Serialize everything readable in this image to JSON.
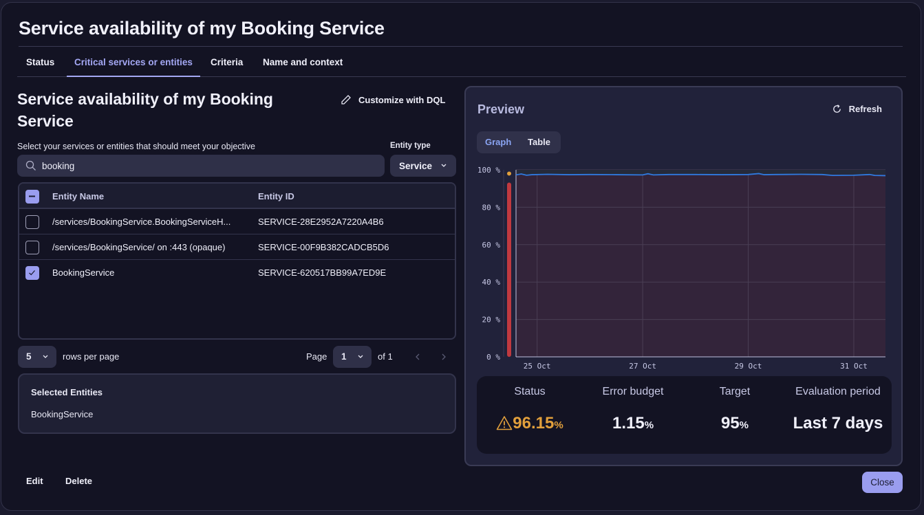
{
  "modal": {
    "title": "Service availability of my Booking Service",
    "tabs": [
      {
        "label": "Status",
        "active": false
      },
      {
        "label": "Critical services or entities",
        "active": true
      },
      {
        "label": "Criteria",
        "active": false
      },
      {
        "label": "Name and context",
        "active": false
      }
    ]
  },
  "left": {
    "title": "Service availability of my Booking Service",
    "customize_label": "Customize with DQL",
    "select_label": "Select your services or entities that should meet your objective",
    "entity_type_label": "Entity type",
    "entity_type_value": "Service",
    "search_value": "booking",
    "table": {
      "headers": [
        "Entity Name",
        "Entity ID"
      ],
      "rows": [
        {
          "name": "/services/BookingService.BookingServiceH...",
          "id": "SERVICE-28E2952A7220A4B6",
          "checked": false
        },
        {
          "name": "/services/BookingService/ on :443 (opaque)",
          "id": "SERVICE-00F9B382CADCB5D6",
          "checked": false
        },
        {
          "name": "BookingService",
          "id": "SERVICE-620517BB99A7ED9E",
          "checked": true
        }
      ]
    },
    "pagination": {
      "rows_per_page": "5",
      "rows_per_page_label": "rows per page",
      "page_label": "Page",
      "page": "1",
      "of_label": "of 1"
    },
    "selected": {
      "title": "Selected Entities",
      "items": [
        "BookingService"
      ]
    }
  },
  "preview": {
    "title": "Preview",
    "refresh_label": "Refresh",
    "view_tabs": [
      {
        "label": "Graph",
        "active": true
      },
      {
        "label": "Table",
        "active": false
      }
    ],
    "stats": [
      {
        "label": "Status",
        "value": "96.15",
        "unit": "%",
        "warning": true
      },
      {
        "label": "Error budget",
        "value": "1.15",
        "unit": "%",
        "warning": false
      },
      {
        "label": "Target",
        "value": "95",
        "unit": "%",
        "warning": false
      },
      {
        "label": "Evaluation period",
        "value": "Last 7 days",
        "unit": "",
        "warning": false
      }
    ]
  },
  "footer": {
    "edit_label": "Edit",
    "delete_label": "Delete",
    "close_label": "Close"
  },
  "colors": {
    "accent": "#9a9def",
    "warning": "#e2a03c",
    "series": "#2f7ae0",
    "status_bar": "#c0393f",
    "plot_bg": "#33243a"
  },
  "chart_data": {
    "type": "line",
    "title": "",
    "xlabel": "",
    "ylabel": "",
    "ylim": [
      0,
      100
    ],
    "y_ticks": [
      "0 %",
      "20 %",
      "40 %",
      "60 %",
      "80 %",
      "100 %"
    ],
    "y_tick_values": [
      0,
      20,
      40,
      60,
      80,
      100
    ],
    "x_ticks": [
      "25 Oct",
      "27 Oct",
      "29 Oct",
      "31 Oct"
    ],
    "x_range_days": [
      24.6,
      31.6
    ],
    "x_tick_days": [
      25,
      27,
      29,
      31
    ],
    "grid": true,
    "series": [
      {
        "name": "availability",
        "x_days": [
          24.6,
          24.7,
          24.8,
          24.9,
          25.2,
          25.6,
          26.0,
          26.5,
          27.0,
          27.1,
          27.2,
          27.5,
          28.0,
          28.5,
          29.0,
          29.2,
          29.3,
          29.5,
          30.0,
          30.4,
          30.6,
          31.0,
          31.3,
          31.4,
          31.6
        ],
        "values": [
          97.3,
          97.8,
          97.1,
          97.4,
          97.6,
          97.4,
          97.5,
          97.4,
          97.3,
          97.9,
          97.3,
          97.5,
          97.5,
          97.4,
          97.5,
          98.0,
          97.4,
          97.5,
          97.6,
          97.5,
          97.0,
          97.1,
          97.5,
          97.0,
          96.9
        ]
      }
    ],
    "status_indicator": {
      "value": 96.15,
      "state": "warning"
    }
  }
}
